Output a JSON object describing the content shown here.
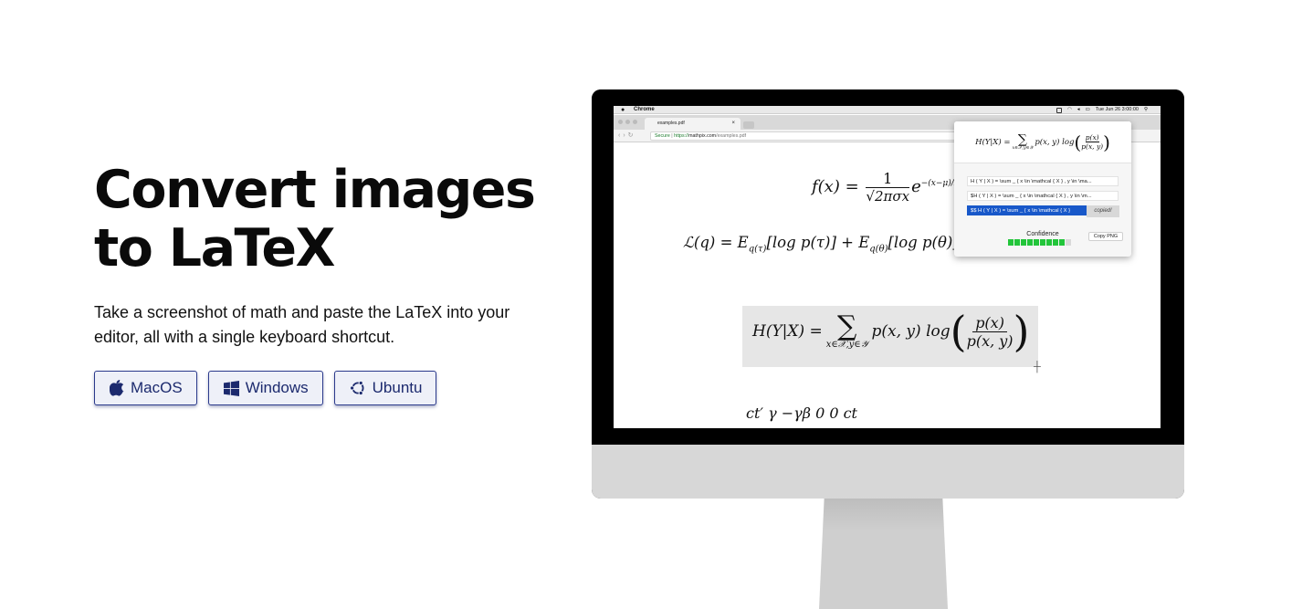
{
  "hero": {
    "title_line1": "Convert images",
    "title_line2": "to LaTeX",
    "subtitle": "Take a screenshot of math and paste the LaTeX into your editor, all with a single keyboard shortcut."
  },
  "os_buttons": [
    {
      "label": "MacOS",
      "icon": "apple-icon"
    },
    {
      "label": "Windows",
      "icon": "windows-icon"
    },
    {
      "label": "Ubuntu",
      "icon": "ubuntu-icon"
    }
  ],
  "colors": {
    "button_border": "#2b3a8c",
    "button_bg": "#eef0f8",
    "button_text": "#1c2a6e",
    "selected_result": "#1858c9",
    "confidence_green": "#22c53a"
  },
  "screen": {
    "menubar": {
      "app_name": "Chrome",
      "datetime": "Tue Jun 26  3:00:00"
    },
    "browser": {
      "tab_title": "examples.pdf",
      "secure_label": "Secure",
      "url_scheme": "https://",
      "url_host": "mathpix.com",
      "url_path": "/examples.pdf"
    },
    "page_math": {
      "fx": "f(x) =",
      "fx_num": "1",
      "fx_den": "√2πσx",
      "fx_exp_base": "e",
      "fx_exp": "−(x−μ)/2σ",
      "lq": "ℒ(q) = E",
      "lq_sub1": "q(τ)",
      "lq_mid": "[log p(τ)] + E",
      "lq_sub2": "q(θ)",
      "lq_end": "[log p(θ)] +",
      "h_left": "H(Y|X) =",
      "h_sum_sub": "x∈𝒳,y∈𝒴",
      "h_body": "p(x, y) log",
      "h_num": "p(x)",
      "h_den": "p(x, y)",
      "matrix_row": "ct′      γ    −γβ   0   0     ct"
    },
    "popup": {
      "results": [
        "H ( Y | X ) = \\sum _ { x \\in \\mathcal { X } , y \\in \\ma...",
        "$H ( Y | X ) = \\sum _ { x \\in \\mathcal { X } , y \\in \\m...",
        "$$ H ( Y | X ) = \\sum _ { x \\in \\mathcal { X }"
      ],
      "copied_label": "copied!",
      "confidence_label": "Confidence",
      "confidence_level": 0.9,
      "copy_png_label": "Copy PNG"
    }
  }
}
